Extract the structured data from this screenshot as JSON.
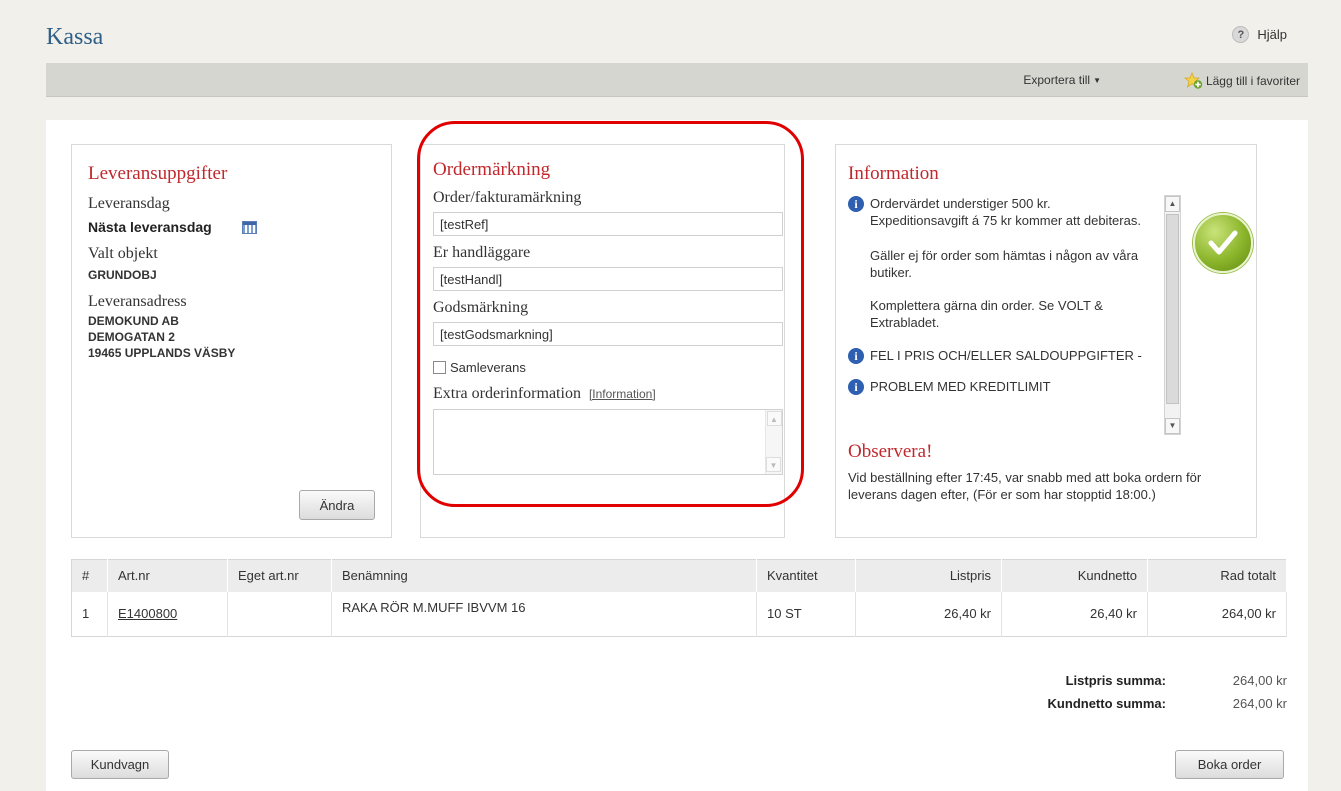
{
  "header": {
    "title": "Kassa",
    "help_label": "Hjälp",
    "export_label": "Exportera till",
    "favorite_label": "Lägg till i favoriter"
  },
  "delivery": {
    "title": "Leveransuppgifter",
    "day_label": "Leveransdag",
    "day_value": "Nästa leveransdag",
    "object_label": "Valt objekt",
    "object_value": "GRUNDOBJ",
    "address_label": "Leveransadress",
    "address_lines": [
      "DEMOKUND AB",
      "DEMOGATAN 2",
      "19465 UPPLANDS VÄSBY"
    ],
    "change_button": "Ändra"
  },
  "order": {
    "title": "Ordermärkning",
    "invoice_label": "Order/fakturamärkning",
    "invoice_value": "[testRef]",
    "handler_label": "Er handläggare",
    "handler_value": "[testHandl]",
    "goods_label": "Godsmärkning",
    "goods_value": "[testGodsmarkning]",
    "combined_label": "Samleverans",
    "extra_label": "Extra orderinformation",
    "extra_link": "[Information]"
  },
  "info": {
    "title": "Information",
    "item1": "Ordervärdet understiger 500 kr. Expeditionsavgift á 75 kr kommer att debiteras.",
    "para1": "Gäller ej för order som hämtas i någon av våra butiker.",
    "para2": "Komplettera gärna din order. Se VOLT & Extrabladet.",
    "item2": "FEL I PRIS OCH/ELLER SALDOUPPGIFTER -",
    "item3": "PROBLEM MED KREDITLIMIT",
    "observe_title": "Observera!",
    "observe_text": "Vid beställning efter 17:45, var snabb med att boka ordern för leverans dagen efter, (För er som har stopptid 18:00.)"
  },
  "table": {
    "headers": [
      "#",
      "Art.nr",
      "Eget art.nr",
      "Benämning",
      "Kvantitet",
      "Listpris",
      "Kundnetto",
      "Rad totalt"
    ],
    "rows": [
      {
        "num": "1",
        "art": "E1400800",
        "own_art": "",
        "name": "RAKA RÖR M.MUFF IBVVM 16",
        "qty": "10  ST",
        "list": "26,40 kr",
        "net": "26,40 kr",
        "total": "264,00 kr"
      }
    ]
  },
  "sums": {
    "list_label": "Listpris summa:",
    "list_value": "264,00 kr",
    "net_label": "Kundnetto summa:",
    "net_value": "264,00 kr"
  },
  "buttons": {
    "cart": "Kundvagn",
    "book": "Boka order"
  },
  "colors": {
    "accent_red": "#c0282d",
    "title_blue": "#2f5f88",
    "highlight": "#e00000"
  }
}
